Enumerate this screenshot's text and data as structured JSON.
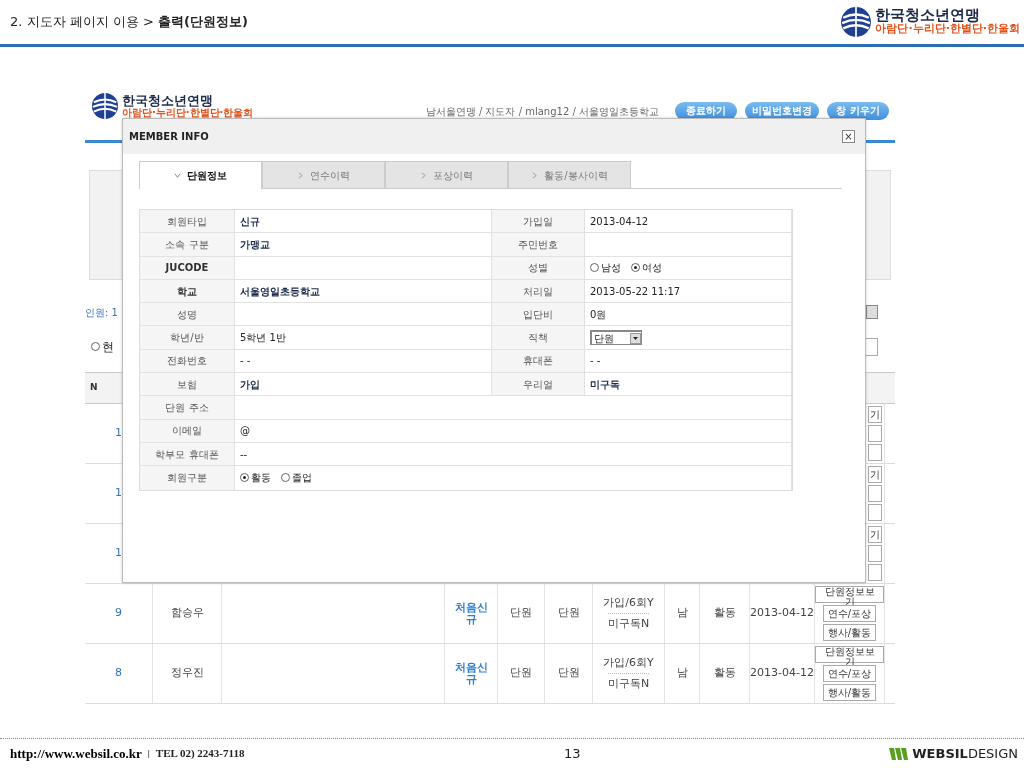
{
  "slide": {
    "title": "2. 지도자 페이지 이용 > **출력(단원정보)**",
    "logo": {
      "name": "한국청소년연맹",
      "tagline": "아람단·누리단·한별단·한울회"
    }
  },
  "site": {
    "logo": {
      "name": "한국청소년연맹",
      "tagline": "아람단·누리단·한별단·한울회"
    },
    "breadcrumb": "남서울연맹 / 지도자 / mlang12 / 서울영일초등학교",
    "buttons": [
      "종료하기",
      "비밀번호변경",
      "창 키우기"
    ],
    "member_count": "인원: 1",
    "filter_radio": {
      "label": "현",
      "checked": false
    },
    "table_header": "N",
    "covered_rows": [
      {
        "no": "1",
        "button": "기"
      },
      {
        "no": "1",
        "button": "기"
      },
      {
        "no": "1",
        "button": "기"
      }
    ],
    "rows": [
      {
        "no": "9",
        "name": "함승우",
        "type": "처음신규",
        "col_5": "단원",
        "col_6": "단원",
        "status": [
          "가입/6회Y",
          "미구독N"
        ],
        "gender": "남",
        "state": "활동",
        "date": "2013-04-12",
        "buttons": [
          "단원정보보기",
          "연수/포상",
          "행사/활동"
        ]
      },
      {
        "no": "8",
        "name": "정우진",
        "type": "처음신규",
        "col_5": "단원",
        "col_6": "단원",
        "status": [
          "가입/6회Y",
          "미구독N"
        ],
        "gender": "남",
        "state": "활동",
        "date": "2013-04-12",
        "buttons": [
          "단원정보보기",
          "연수/포상",
          "행사/활동"
        ]
      }
    ]
  },
  "modal": {
    "title": "MEMBER INFO",
    "close": "×",
    "tabs": [
      {
        "label": "단원정보",
        "selected": true
      },
      {
        "label": "연수이력",
        "selected": false
      },
      {
        "label": "포상이력",
        "selected": false
      },
      {
        "label": "활동/봉사이력",
        "selected": false
      }
    ],
    "rows": [
      {
        "cells": [
          {
            "label": "회원타입",
            "value": "신규",
            "bold": true
          },
          {
            "label": "가입일",
            "value": "2013-04-12",
            "bold": false
          }
        ]
      },
      {
        "cells": [
          {
            "label": "소속 구분",
            "value": "가맹교",
            "bold": true
          },
          {
            "label": "주민번호"
          }
        ]
      },
      {
        "cells": [
          {
            "label": "JUCODE",
            "label_bold": true
          },
          {
            "label": "성별",
            "kind": "radio",
            "options": [
              {
                "label": "남성",
                "selected": false
              },
              {
                "label": "여성",
                "selected": true
              }
            ]
          }
        ]
      },
      {
        "cells": [
          {
            "label": "학교",
            "label_bold": true,
            "value": "서울영일초등학교",
            "bold": true
          },
          {
            "label": "처리일",
            "value": "2013-05-22 11:17",
            "bold": false
          }
        ]
      },
      {
        "cells": [
          {
            "label": "성명"
          },
          {
            "label": "입단비",
            "value": "0원",
            "bold": false
          }
        ]
      },
      {
        "cells": [
          {
            "label": "학년/반",
            "value": "5학년 1반",
            "bold": false
          },
          {
            "label": "직책",
            "kind": "select",
            "value": "단원"
          }
        ]
      },
      {
        "cells": [
          {
            "label": "전화번호",
            "value": "- -",
            "bold": false
          },
          {
            "label": "휴대폰",
            "value": "- -",
            "bold": false
          }
        ]
      },
      {
        "cells": [
          {
            "label": "보험",
            "value": "가입",
            "bold": true
          },
          {
            "label": "우리얼",
            "value": "미구독",
            "bold": true
          }
        ]
      },
      {
        "cells": [
          {
            "label": "단원 주소"
          }
        ]
      },
      {
        "cells": [
          {
            "label": "이메일",
            "value": "@",
            "bold": false
          }
        ]
      },
      {
        "cells": [
          {
            "label": "학부모 휴대폰",
            "value": "--",
            "bold": false
          }
        ]
      },
      {
        "cells": [
          {
            "label": "회원구분",
            "kind": "radio",
            "options": [
              {
                "label": "활동",
                "selected": true
              },
              {
                "label": "졸업",
                "selected": false
              }
            ]
          }
        ]
      }
    ]
  },
  "footer": {
    "url": "http://www.websil.co.kr",
    "separator": "|",
    "tel": "TEL 02) 2243-7118",
    "page": "13",
    "logo": "**WEBSIL**DESIGN"
  }
}
